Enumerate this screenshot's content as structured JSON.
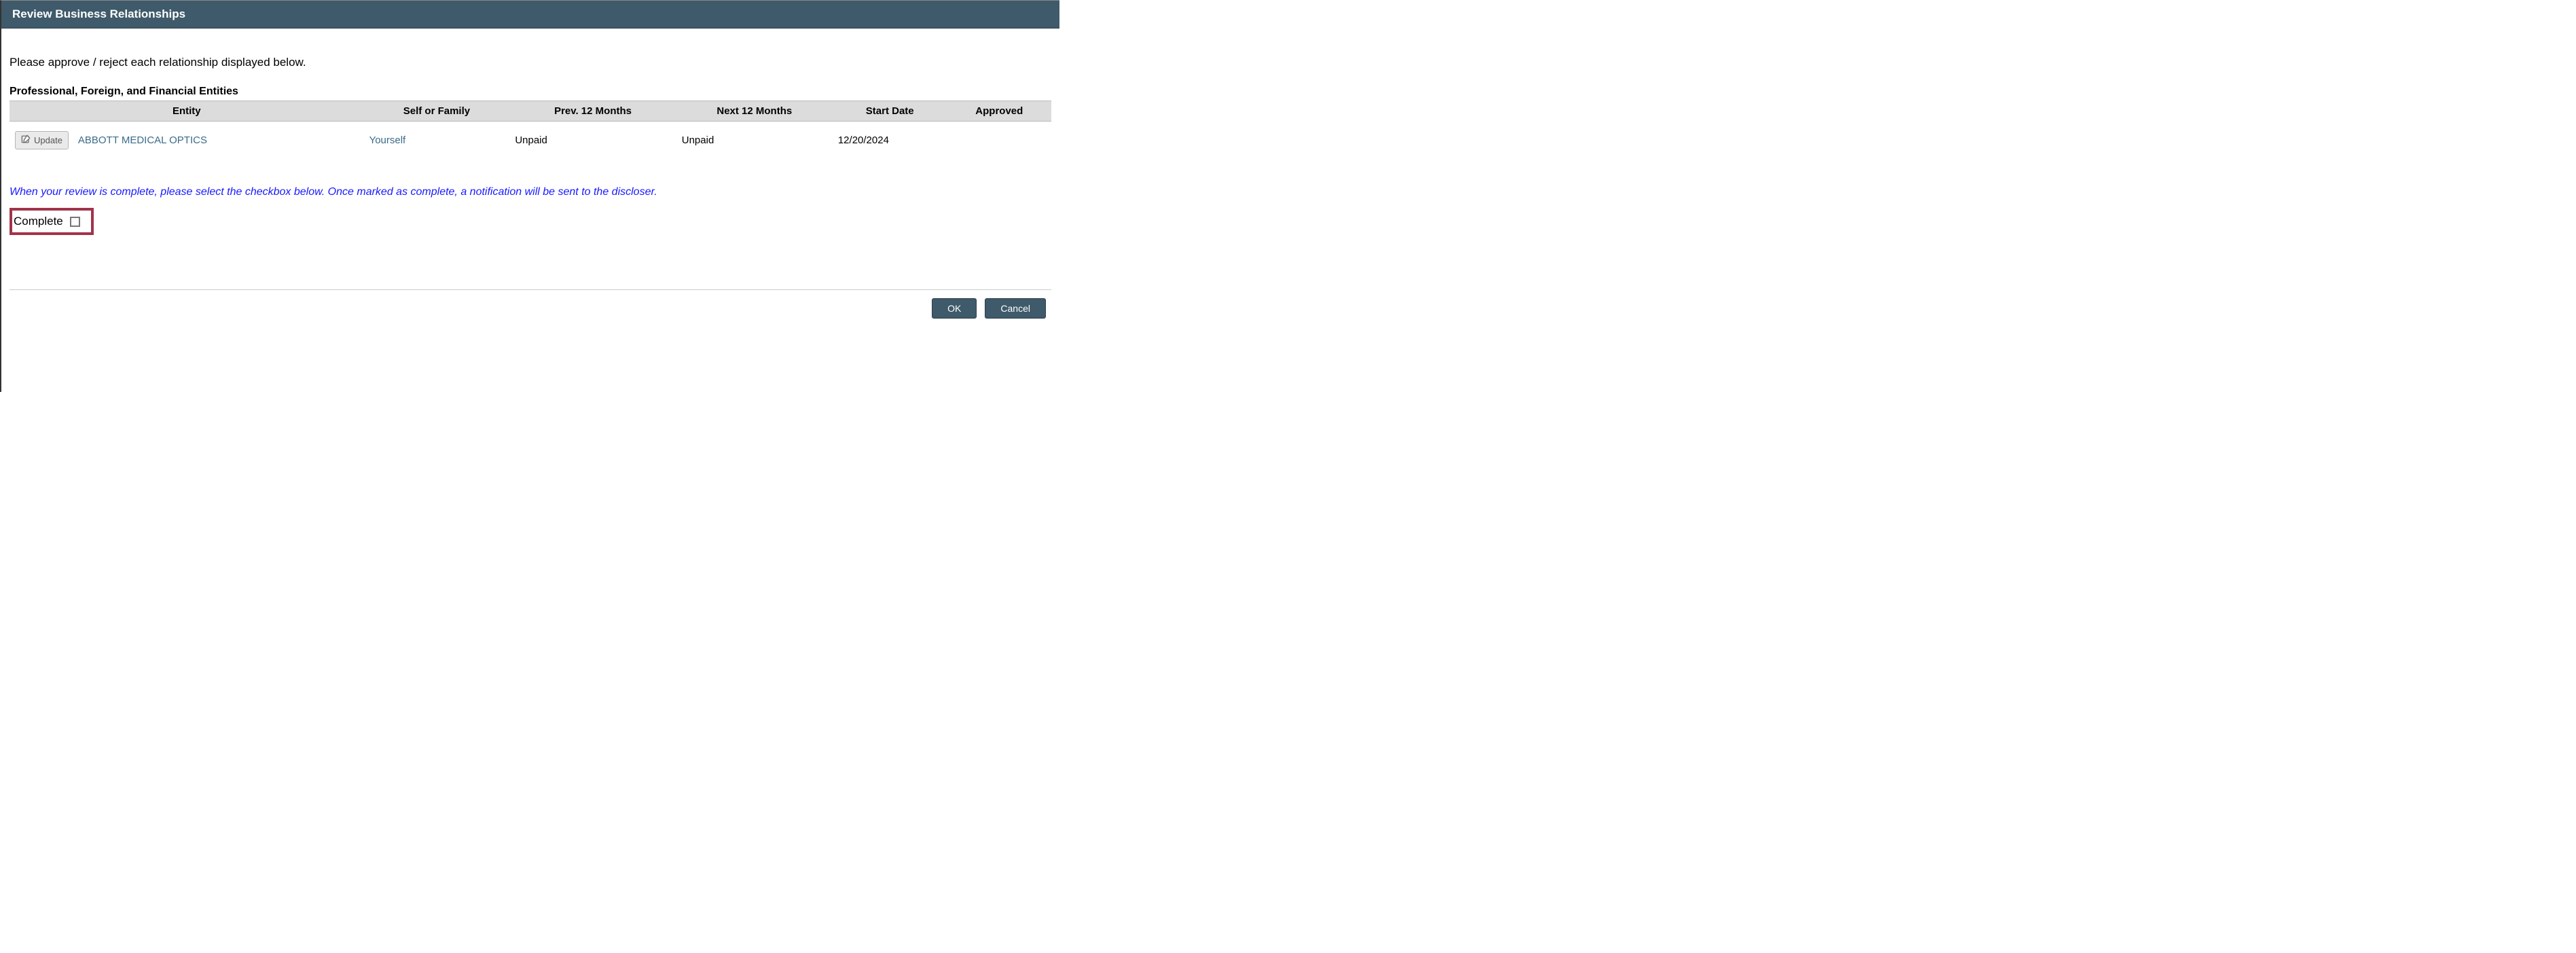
{
  "header": {
    "title": "Review Business Relationships"
  },
  "intro": "Please approve / reject each relationship displayed below.",
  "section_title": "Professional, Foreign, and Financial Entities",
  "table": {
    "headers": {
      "entity": "Entity",
      "self": "Self or Family",
      "prev": "Prev. 12 Months",
      "next": "Next 12 Months",
      "start": "Start Date",
      "approved": "Approved"
    },
    "rows": [
      {
        "update_label": "Update",
        "entity": "ABBOTT MEDICAL OPTICS",
        "self": "Yourself",
        "prev": "Unpaid",
        "next": "Unpaid",
        "start": "12/20/2024",
        "approved": ""
      }
    ]
  },
  "notice": "When your review is complete, please select the checkbox below. Once marked as complete, a notification will be sent to the discloser.",
  "complete_label": "Complete",
  "buttons": {
    "ok": "OK",
    "cancel": "Cancel"
  }
}
